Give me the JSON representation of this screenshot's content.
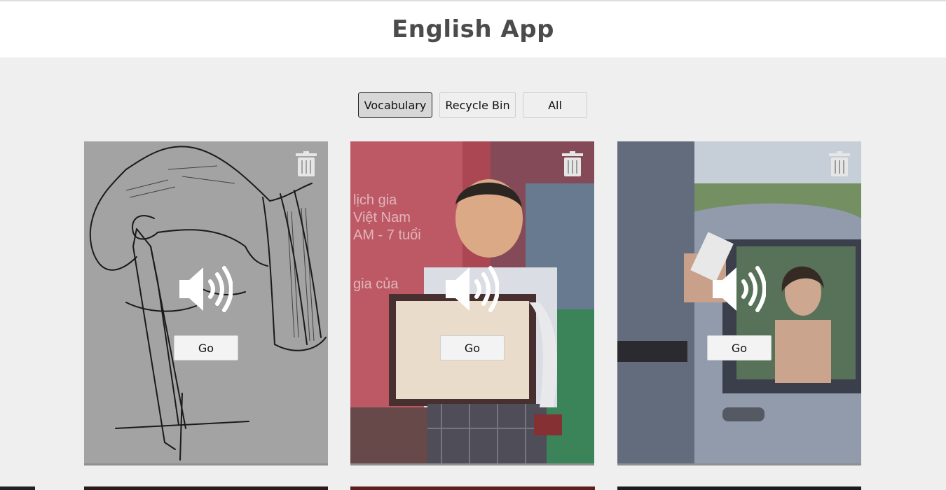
{
  "app": {
    "title": "English App"
  },
  "tabs": [
    {
      "label": "Vocabulary",
      "active": true
    },
    {
      "label": "Recycle Bin",
      "active": false
    },
    {
      "label": "All",
      "active": false
    }
  ],
  "cards": [
    {
      "image": "drawing-hand-compass-sketch",
      "button_label": "Go"
    },
    {
      "image": "child-holding-certificate-photo",
      "button_label": "Go"
    },
    {
      "image": "officer-writing-ticket-car-photo",
      "button_label": "Go"
    }
  ],
  "icons": {
    "delete": "trash-icon",
    "audio": "speaker-icon"
  },
  "colors": {
    "header_bg": "#ffffff",
    "page_bg": "#efefef",
    "title_text": "#4b4b4b",
    "active_tab_bg": "#d7d7d7"
  }
}
